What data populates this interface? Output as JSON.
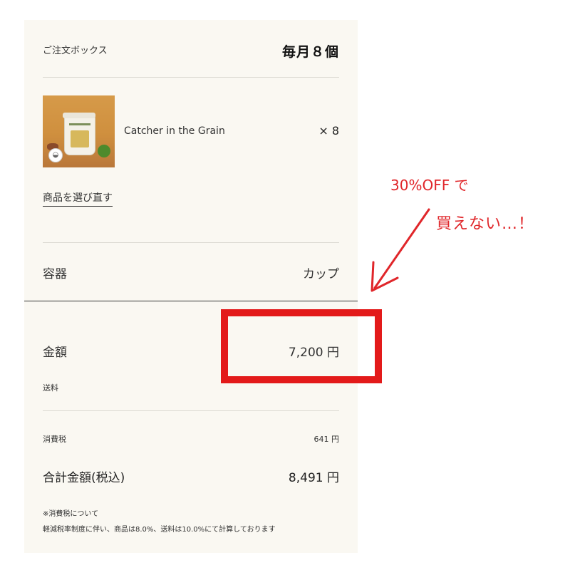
{
  "order_box": {
    "label": "ご注文ボックス",
    "count": "毎月８個"
  },
  "product": {
    "name": "Catcher in the Grain",
    "quantity": "× 8",
    "image_icon": "bowl-spoon-icon"
  },
  "reselect_link": "商品を選び直す",
  "container": {
    "label": "容器",
    "value": "カップ"
  },
  "pricing": {
    "amount_label": "金額",
    "amount_value": "7,200 円",
    "shipping_label": "送料",
    "tax_label": "消費税",
    "tax_value": "641 円",
    "total_label": "合計金額(税込)",
    "total_value": "8,491 円"
  },
  "notes": {
    "title": "※消費税について",
    "body": "軽減税率制度に伴い、商品は8.0%、送料は10.0%にて計算しております"
  },
  "annotation": {
    "line1": "30%OFF で",
    "line2": "買えない…！",
    "color": "#e0262a"
  },
  "colors": {
    "panel_bg": "#faf8f2",
    "highlight": "#e31a1a"
  }
}
